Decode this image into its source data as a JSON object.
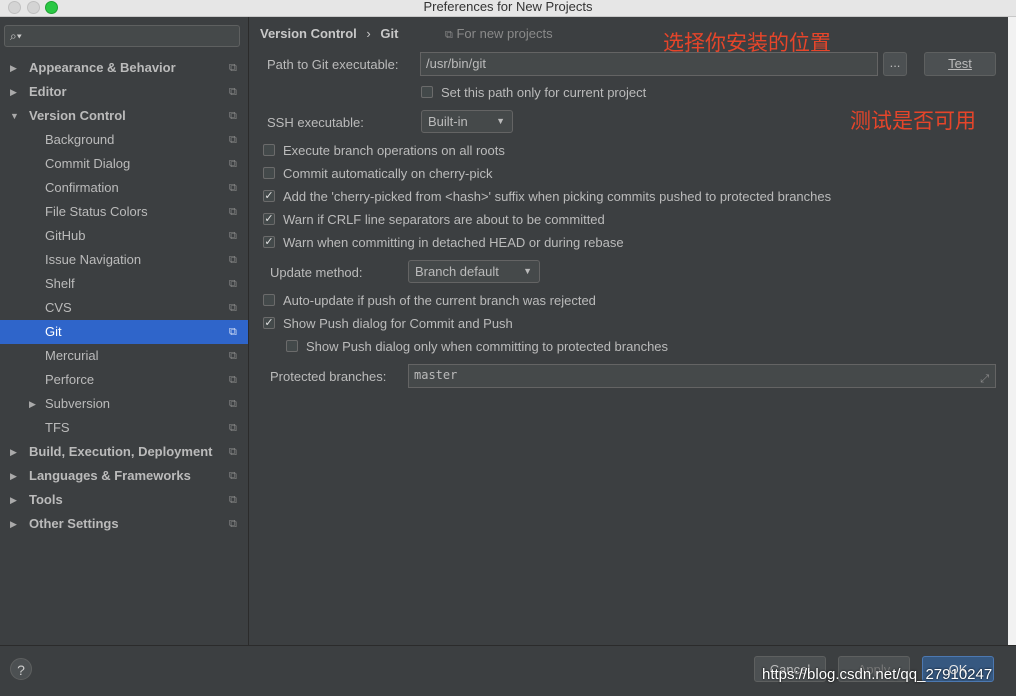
{
  "window": {
    "title": "Preferences for New Projects"
  },
  "sidebar": {
    "search_placeholder": "",
    "items": [
      {
        "label": "Appearance & Behavior"
      },
      {
        "label": "Editor"
      },
      {
        "label": "Version Control"
      },
      {
        "label": "Background"
      },
      {
        "label": "Commit Dialog"
      },
      {
        "label": "Confirmation"
      },
      {
        "label": "File Status Colors"
      },
      {
        "label": "GitHub"
      },
      {
        "label": "Issue Navigation"
      },
      {
        "label": "Shelf"
      },
      {
        "label": "CVS"
      },
      {
        "label": "Git"
      },
      {
        "label": "Mercurial"
      },
      {
        "label": "Perforce"
      },
      {
        "label": "Subversion"
      },
      {
        "label": "TFS"
      },
      {
        "label": "Build, Execution, Deployment"
      },
      {
        "label": "Languages & Frameworks"
      },
      {
        "label": "Tools"
      },
      {
        "label": "Other Settings"
      }
    ]
  },
  "breadcrumb": {
    "parent": "Version Control",
    "sep": "›",
    "current": "Git",
    "note": "For new projects"
  },
  "annotations": {
    "choose_location": "选择你安装的位置",
    "test_available": "测试是否可用"
  },
  "git": {
    "path_label": "Path to Git executable:",
    "path_value": "/usr/bin/git",
    "browse_label": "...",
    "test_label": "Test",
    "current_project_only": "Set this path only for current project",
    "ssh_label": "SSH executable:",
    "ssh_value": "Built-in",
    "opt_branch_all_roots": "Execute branch operations on all roots",
    "opt_commit_cherry": "Commit automatically on cherry-pick",
    "opt_cherry_suffix": "Add the 'cherry-picked from <hash>' suffix when picking commits pushed to protected branches",
    "opt_crlf": "Warn if CRLF line separators are about to be committed",
    "opt_detached": "Warn when committing in detached HEAD or during rebase",
    "update_label": "Update method:",
    "update_value": "Branch default",
    "opt_auto_update": "Auto-update if push of the current branch was rejected",
    "opt_show_push": "Show Push dialog for Commit and Push",
    "opt_push_protected": "Show Push dialog only when committing to protected branches",
    "protected_label": "Protected branches:",
    "protected_value": "master"
  },
  "footer": {
    "help": "?",
    "cancel": "Cancel",
    "apply": "Apply",
    "ok": "OK"
  },
  "watermark": "https://blog.csdn.net/qq_27910247",
  "colors": {
    "selection": "#2f65ca",
    "annotation": "#e6452a",
    "ok_button": "#365880"
  }
}
